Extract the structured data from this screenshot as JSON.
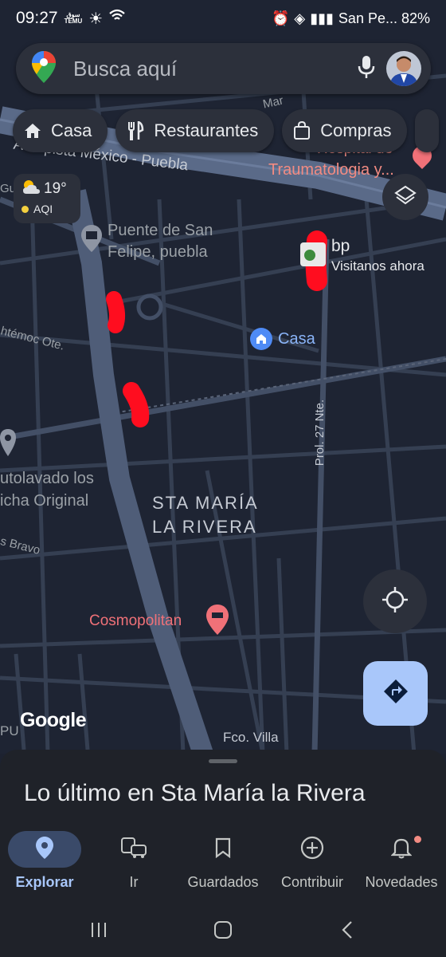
{
  "status_bar": {
    "time": "09:27",
    "temu_line1": "ﺳﻮﻕ",
    "temu_line2": "TEMU",
    "right_text": "San Pe... 82%"
  },
  "search": {
    "placeholder": "Busca aquí"
  },
  "chips": [
    {
      "label": "Casa",
      "icon": "home-icon"
    },
    {
      "label": "Restaurantes",
      "icon": "restaurant-icon"
    },
    {
      "label": "Compras",
      "icon": "shopping-bag-icon"
    }
  ],
  "weather": {
    "temperature": "19°",
    "aqi_label": "AQI"
  },
  "map": {
    "highway_label": "Autopista México - Puebla",
    "hospital_label": "Traumatologia y...",
    "hospital_top": "Hospital de",
    "place_bridge_line1": "Puente de San",
    "place_bridge_line2": "Felipe, puebla",
    "bp_name": "bp",
    "bp_sub": "Visitanos ahora",
    "home_label": "Casa",
    "street_cuauhtemoc": "htémoc Ote.",
    "street_27": "Prol. 27 Nte.",
    "carwash_line1": "utolavado los",
    "carwash_line2": "icha Original",
    "street_bravo": "s Bravo",
    "neighborhood_line1": "STA MARÍA",
    "neighborhood_line2": "LA RIVERA",
    "hotel_label": "Cosmopolitan",
    "street_fco": "Fco. Villa",
    "google_logo": "Google",
    "street_mar": "Mar",
    "street_gu": "Gu",
    "street_pu": "PU"
  },
  "sheet": {
    "title": "Lo último en Sta María la Rivera"
  },
  "bottom_nav": [
    {
      "label": "Explorar",
      "icon": "explore-pin-icon",
      "active": true
    },
    {
      "label": "Ir",
      "icon": "commute-icon",
      "active": false
    },
    {
      "label": "Guardados",
      "icon": "bookmark-icon",
      "active": false
    },
    {
      "label": "Contribuir",
      "icon": "add-circle-icon",
      "active": false
    },
    {
      "label": "Novedades",
      "icon": "bell-icon",
      "active": false
    }
  ],
  "colors": {
    "map_bg": "#1e2433",
    "road": "#3a4558",
    "highway": "#4d5b75",
    "accent": "#a8c7fa",
    "annotation_red": "#ff0d1f",
    "hotel_pink": "#f07178"
  }
}
